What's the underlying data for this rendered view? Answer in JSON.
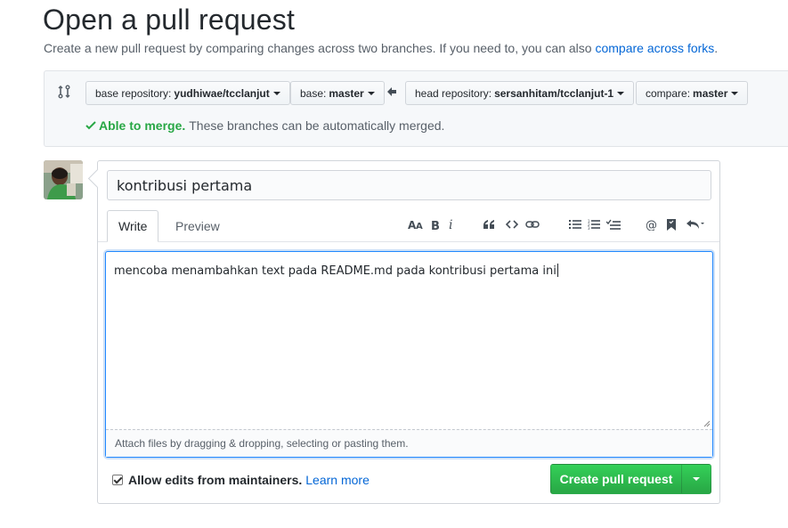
{
  "page": {
    "title": "Open a pull request",
    "subtitle": "Create a new pull request by comparing changes across two branches. If you need to, you can also",
    "subtitle_link": "compare across forks",
    "subtitle_end": "."
  },
  "range": {
    "base_repo_label": "base repository:",
    "base_repo_value": "yudhiwae/tcclanjut",
    "base_label": "base:",
    "base_value": "master",
    "head_repo_label": "head repository:",
    "head_repo_value": "sersanhitam/tcclanjut-1",
    "compare_label": "compare:",
    "compare_value": "master",
    "merge_ok": "Able to merge.",
    "merge_text": "These branches can be automatically merged."
  },
  "form": {
    "title_value": "kontribusi pertama",
    "tabs": {
      "write": "Write",
      "preview": "Preview"
    },
    "body_value": "mencoba menambahkan text pada README.md pada kontribusi pertama ini",
    "attach_text": "Attach files by dragging & dropping, selecting or pasting them.",
    "allow_label": "Allow edits from maintainers.",
    "learn_more": "Learn more",
    "allow_checked": true,
    "create_label": "Create pull request"
  },
  "colors": {
    "accent": "#0366d6",
    "success": "#28a745",
    "button_green": "#2cbe4e"
  },
  "icons": [
    "compare-icon",
    "arrow-left-icon",
    "check-icon",
    "text-size-icon",
    "bold-icon",
    "italic-icon",
    "quote-icon",
    "code-icon",
    "link-icon",
    "unordered-list-icon",
    "ordered-list-icon",
    "tasklist-icon",
    "mention-icon",
    "bookmark-icon",
    "reply-icon"
  ]
}
